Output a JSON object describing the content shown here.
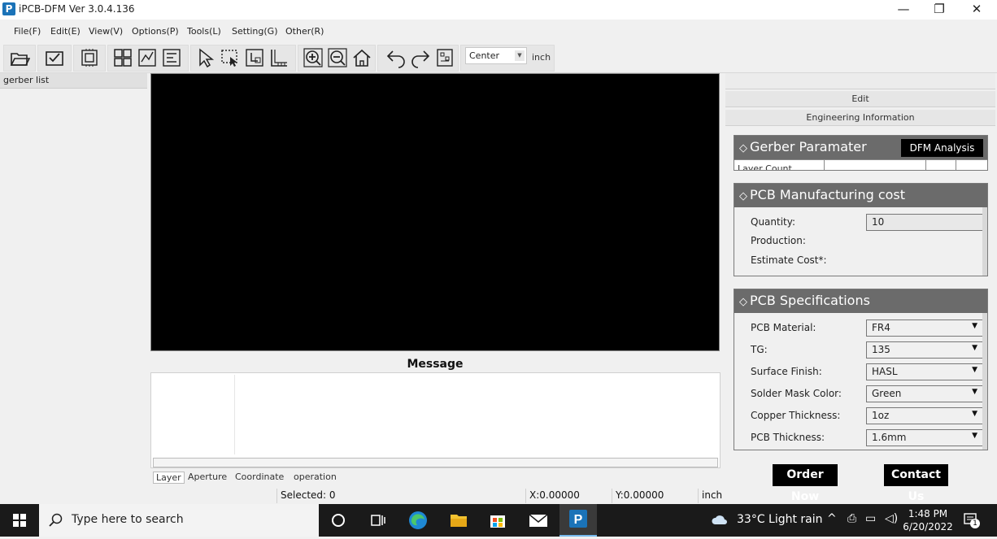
{
  "window": {
    "title": "iPCB-DFM Ver 3.0.4.136",
    "minimize": "—",
    "restore": "❐",
    "close": "✕"
  },
  "menu": [
    "File(F)",
    "Edit(E)",
    "View(V)",
    "Options(P)",
    "Tools(L)",
    "Setting(G)",
    "Other(R)"
  ],
  "toolbar": {
    "origin_value": "Center",
    "unit": "inch"
  },
  "left_panel": {
    "header": "gerber list"
  },
  "message": {
    "title": "Message",
    "tabs": [
      "Layer",
      "Aperture",
      "Coordinate",
      "operation"
    ]
  },
  "status": {
    "selected": "Selected: 0",
    "x": "X:0.00000",
    "y": "Y:0.00000",
    "unit": "inch"
  },
  "right_panel": {
    "edit_strip": "Edit",
    "eng_strip": "Engineering Information",
    "gerber_section": {
      "title": "Gerber Paramater",
      "dfm_button": "DFM Analysis",
      "partial_text": "Layer Count"
    },
    "cost_section": {
      "title": "PCB Manufacturing cost",
      "quantity_label": "Quantity:",
      "quantity_value": "10",
      "production_label": "Production:",
      "estimate_label": "Estimate Cost*:"
    },
    "spec_section": {
      "title": "PCB Specifications",
      "rows": [
        {
          "label": "PCB Material:",
          "value": "FR4"
        },
        {
          "label": "TG:",
          "value": "135"
        },
        {
          "label": "Surface Finish:",
          "value": "HASL"
        },
        {
          "label": "Solder Mask Color:",
          "value": "Green"
        },
        {
          "label": "Copper Thickness:",
          "value": "1oz"
        },
        {
          "label": "PCB Thickness:",
          "value": "1.6mm"
        }
      ]
    },
    "order_button": "Order Now",
    "contact_button": "Contact Us"
  },
  "taskbar": {
    "search_placeholder": "Type here to search",
    "weather": "33°C  Light rain",
    "time": "1:48 PM",
    "date": "6/20/2022",
    "notification_count": "1"
  }
}
